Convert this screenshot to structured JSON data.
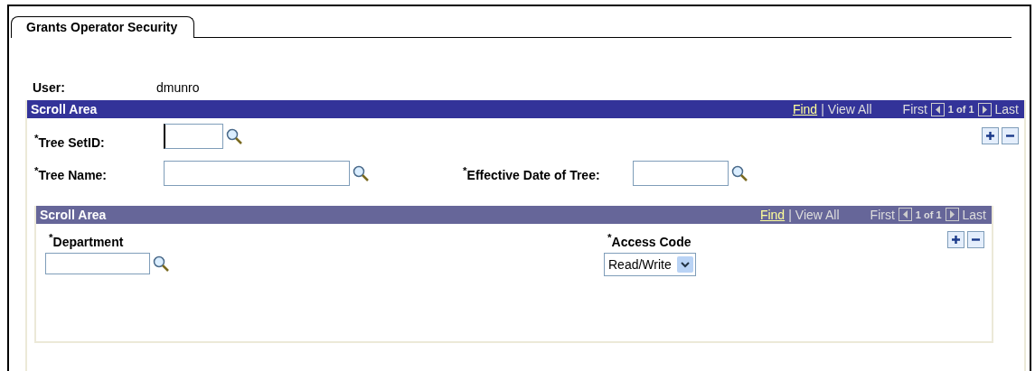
{
  "tab": {
    "label": "Grants Operator Security",
    "selected": true
  },
  "user": {
    "label": "User:",
    "value": "dmunro"
  },
  "scroll_area": {
    "title": "Scroll Area",
    "find": "Find",
    "separator": "|",
    "view_all": "View All",
    "first": "First",
    "position": "1 of 1",
    "last": "Last",
    "fields": [
      {
        "label": "$^{*}$Tree SetID:",
        "kind": "lookup",
        "focused": true
      },
      {
        "label": "$^{*}$Tree Name:",
        "kind": "lookup",
        "focused": false
      },
      {
        "label": "$^{*}$Effective Date of Tree:",
        "kind": "lookup",
        "focused": false
      }
    ],
    "inner_scroll_area": {
      "title": "Scroll Area",
      "find": "Find",
      "separator": "|",
      "view_all": "View All",
      "first": "First",
      "position": "1 of 1",
      "last": "Last",
      "columns": [
        {
          "label": "$^{*}$Department",
          "kind": "lookup"
        },
        {
          "label": "$^{*}$Access Code",
          "kind": "select",
          "value": "Read/Write"
        }
      ]
    }
  }
}
